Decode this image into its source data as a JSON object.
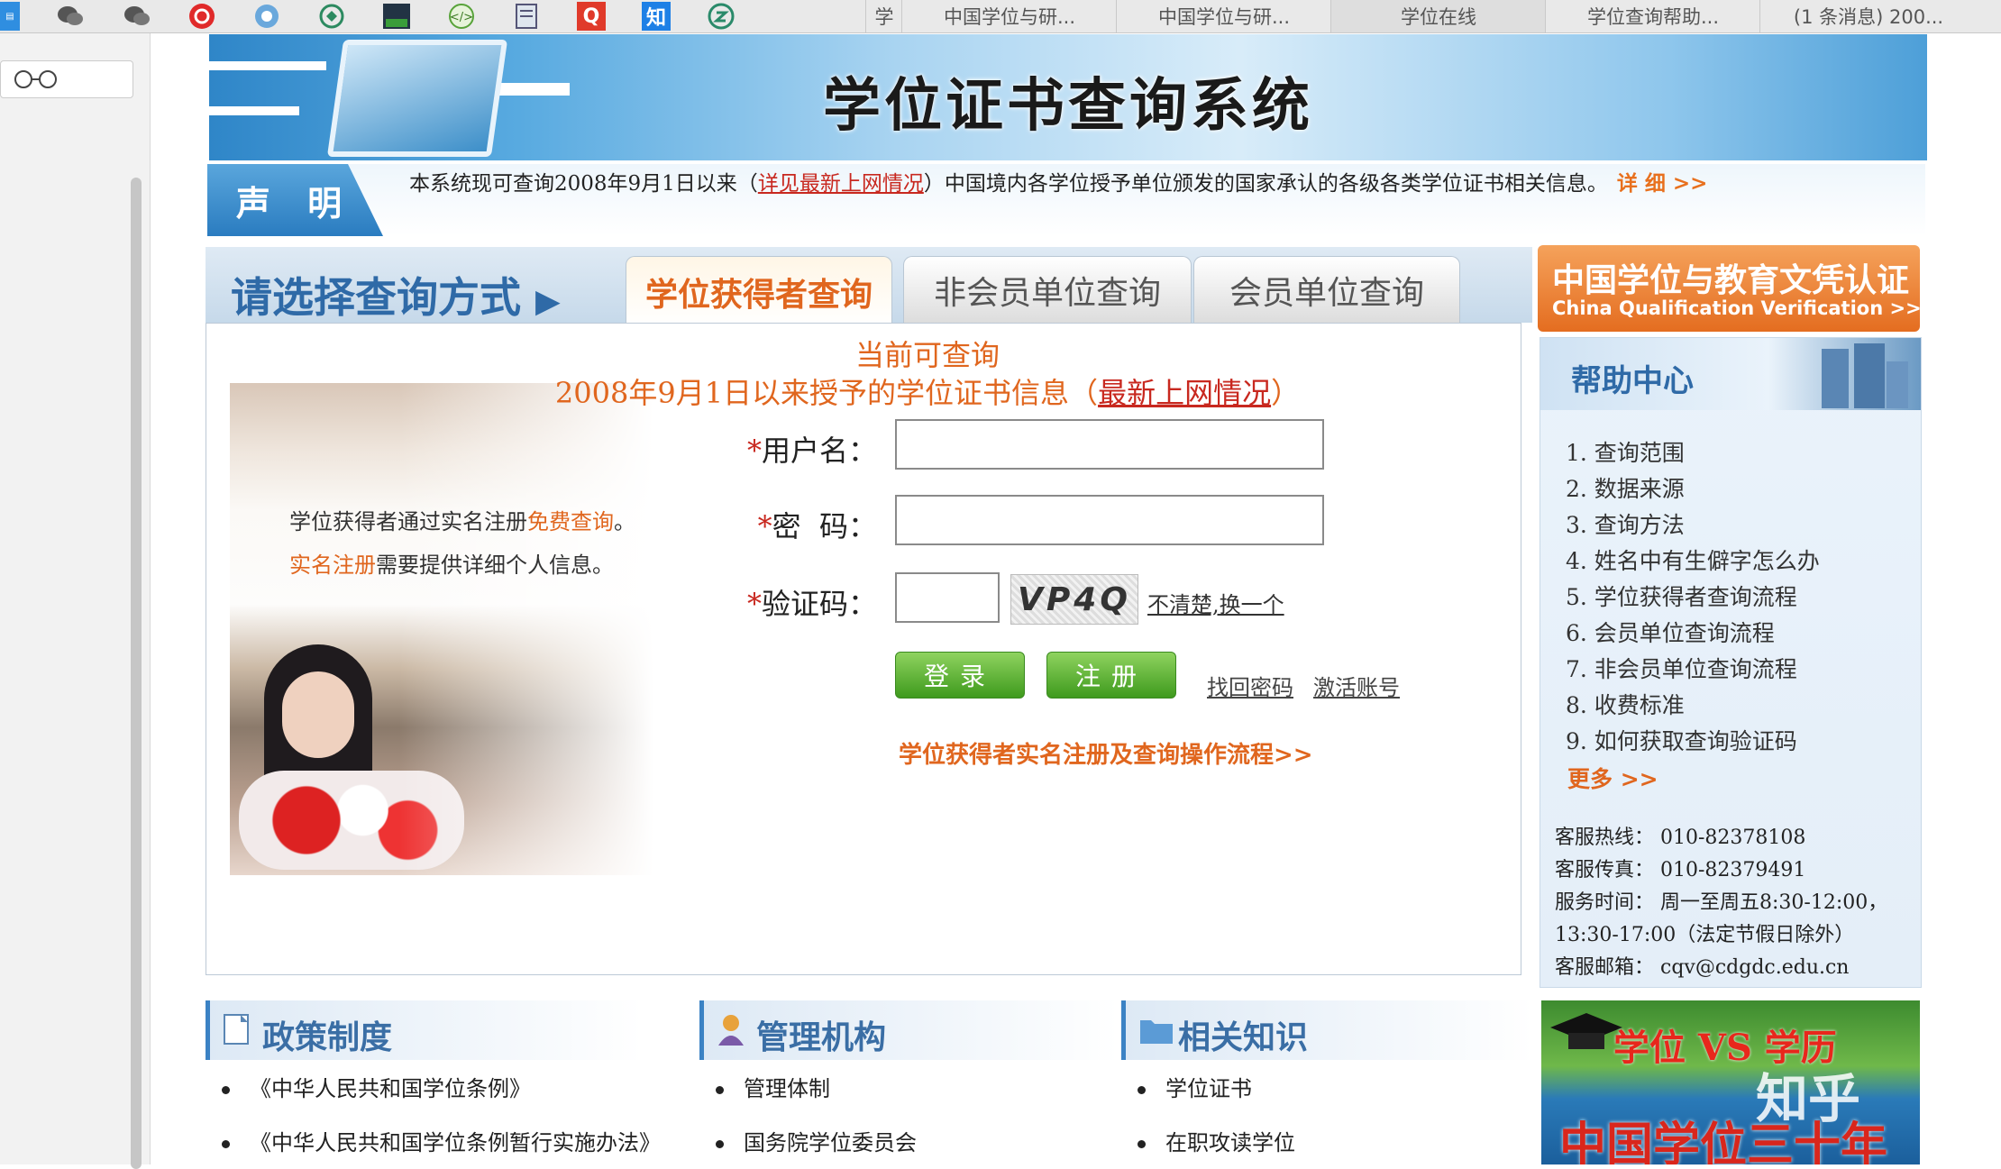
{
  "browser": {
    "tabs": [
      "学",
      "中国学位与研...",
      "中国学位与研...",
      "学位在线",
      "学位查询帮助...",
      "(1 条消息) 200..."
    ],
    "extension_icons": [
      "bookmark-icon",
      "wechat-icon",
      "wechat-icon",
      "weibo-icon",
      "edge-icon",
      "vpn-icon",
      "image-icon",
      "code-icon",
      "notes-icon",
      "q-icon",
      "zhihu-icon",
      "translate-icon"
    ],
    "zhihu_icon_text": "知",
    "q_icon_text": "Q"
  },
  "header": {
    "title": "学位证书查询系统",
    "notice_label": "声 明",
    "notice_text_before": "本系统现可查询2008年9月1日以来（",
    "notice_link": "详见最新上网情况",
    "notice_text_after": "）中国境内各学位授予单位颁发的国家承认的各级各类学位证书相关信息。",
    "notice_more": "详 细 >>"
  },
  "query": {
    "method_label": "请选择查询方式",
    "tabs": [
      "学位获得者查询",
      "非会员单位查询",
      "会员单位查询"
    ],
    "active_tab": 0,
    "current_title": "当前可查询",
    "current_sub_before": "2008年9月1日以来授予的学位证书信息（",
    "current_sub_link": "最新上网情况",
    "current_sub_after": "）",
    "photo_text1_before": "学位获得者通过实名注册",
    "photo_text1_highlight": "免费查询",
    "photo_text1_after": "。",
    "photo_text2_highlight": "实名注册",
    "photo_text2_after": "需要提供详细个人信息。",
    "form": {
      "username_label": "用户名：",
      "password_label": "密  码：",
      "captcha_label": "验证码：",
      "required_mark": "*",
      "username_value": "",
      "password_value": "",
      "captcha_value": "",
      "captcha_image_text": "VP4Q",
      "captcha_change": "不清楚,换一个",
      "login_button": "登录",
      "register_button": "注册",
      "forgot_password": "找回密码",
      "activate_account": "激活账号",
      "flow_link": "学位获得者实名注册及查询操作流程>>"
    }
  },
  "sidebar": {
    "cqv_title": "中国学位与教育文凭认证",
    "cqv_subtitle": "China Qualification Verification >>",
    "help_title": "帮助中心",
    "help_items": [
      "1. 查询范围",
      "2. 数据来源",
      "3. 查询方法",
      "4. 姓名中有生僻字怎么办",
      "5. 学位获得者查询流程",
      "6. 会员单位查询流程",
      "7. 非会员单位查询流程",
      "8. 收费标准",
      "9. 如何获取查询验证码"
    ],
    "help_more": "更多 >>",
    "contact": {
      "hotline": "客服热线：  010-82378108",
      "fax": "客服传真：  010-82379491",
      "hours": "服务时间：  周一至周五8:30-12:00，",
      "hours2": "13:30-17:00（法定节假日除外）",
      "email": "客服邮箱：  cqv@cdgdc.edu.cn"
    },
    "promo_top": "学位 VS 学历",
    "promo_bottom": "中国学位三十年"
  },
  "bottom": {
    "sections": [
      {
        "title": "政策制度",
        "items": [
          "《中华人民共和国学位条例》",
          "《中华人民共和国学位条例暂行实施办法》"
        ]
      },
      {
        "title": "管理机构",
        "items": [
          "管理体制",
          "国务院学位委员会"
        ]
      },
      {
        "title": "相关知识",
        "items": [
          "学位证书",
          "在职攻读学位"
        ]
      }
    ]
  },
  "watermark": "知乎",
  "colors": {
    "accent_orange": "#e0661e",
    "link_red": "#c8281f",
    "title_blue": "#2f6aa7",
    "button_green": "#3e9a1d"
  }
}
